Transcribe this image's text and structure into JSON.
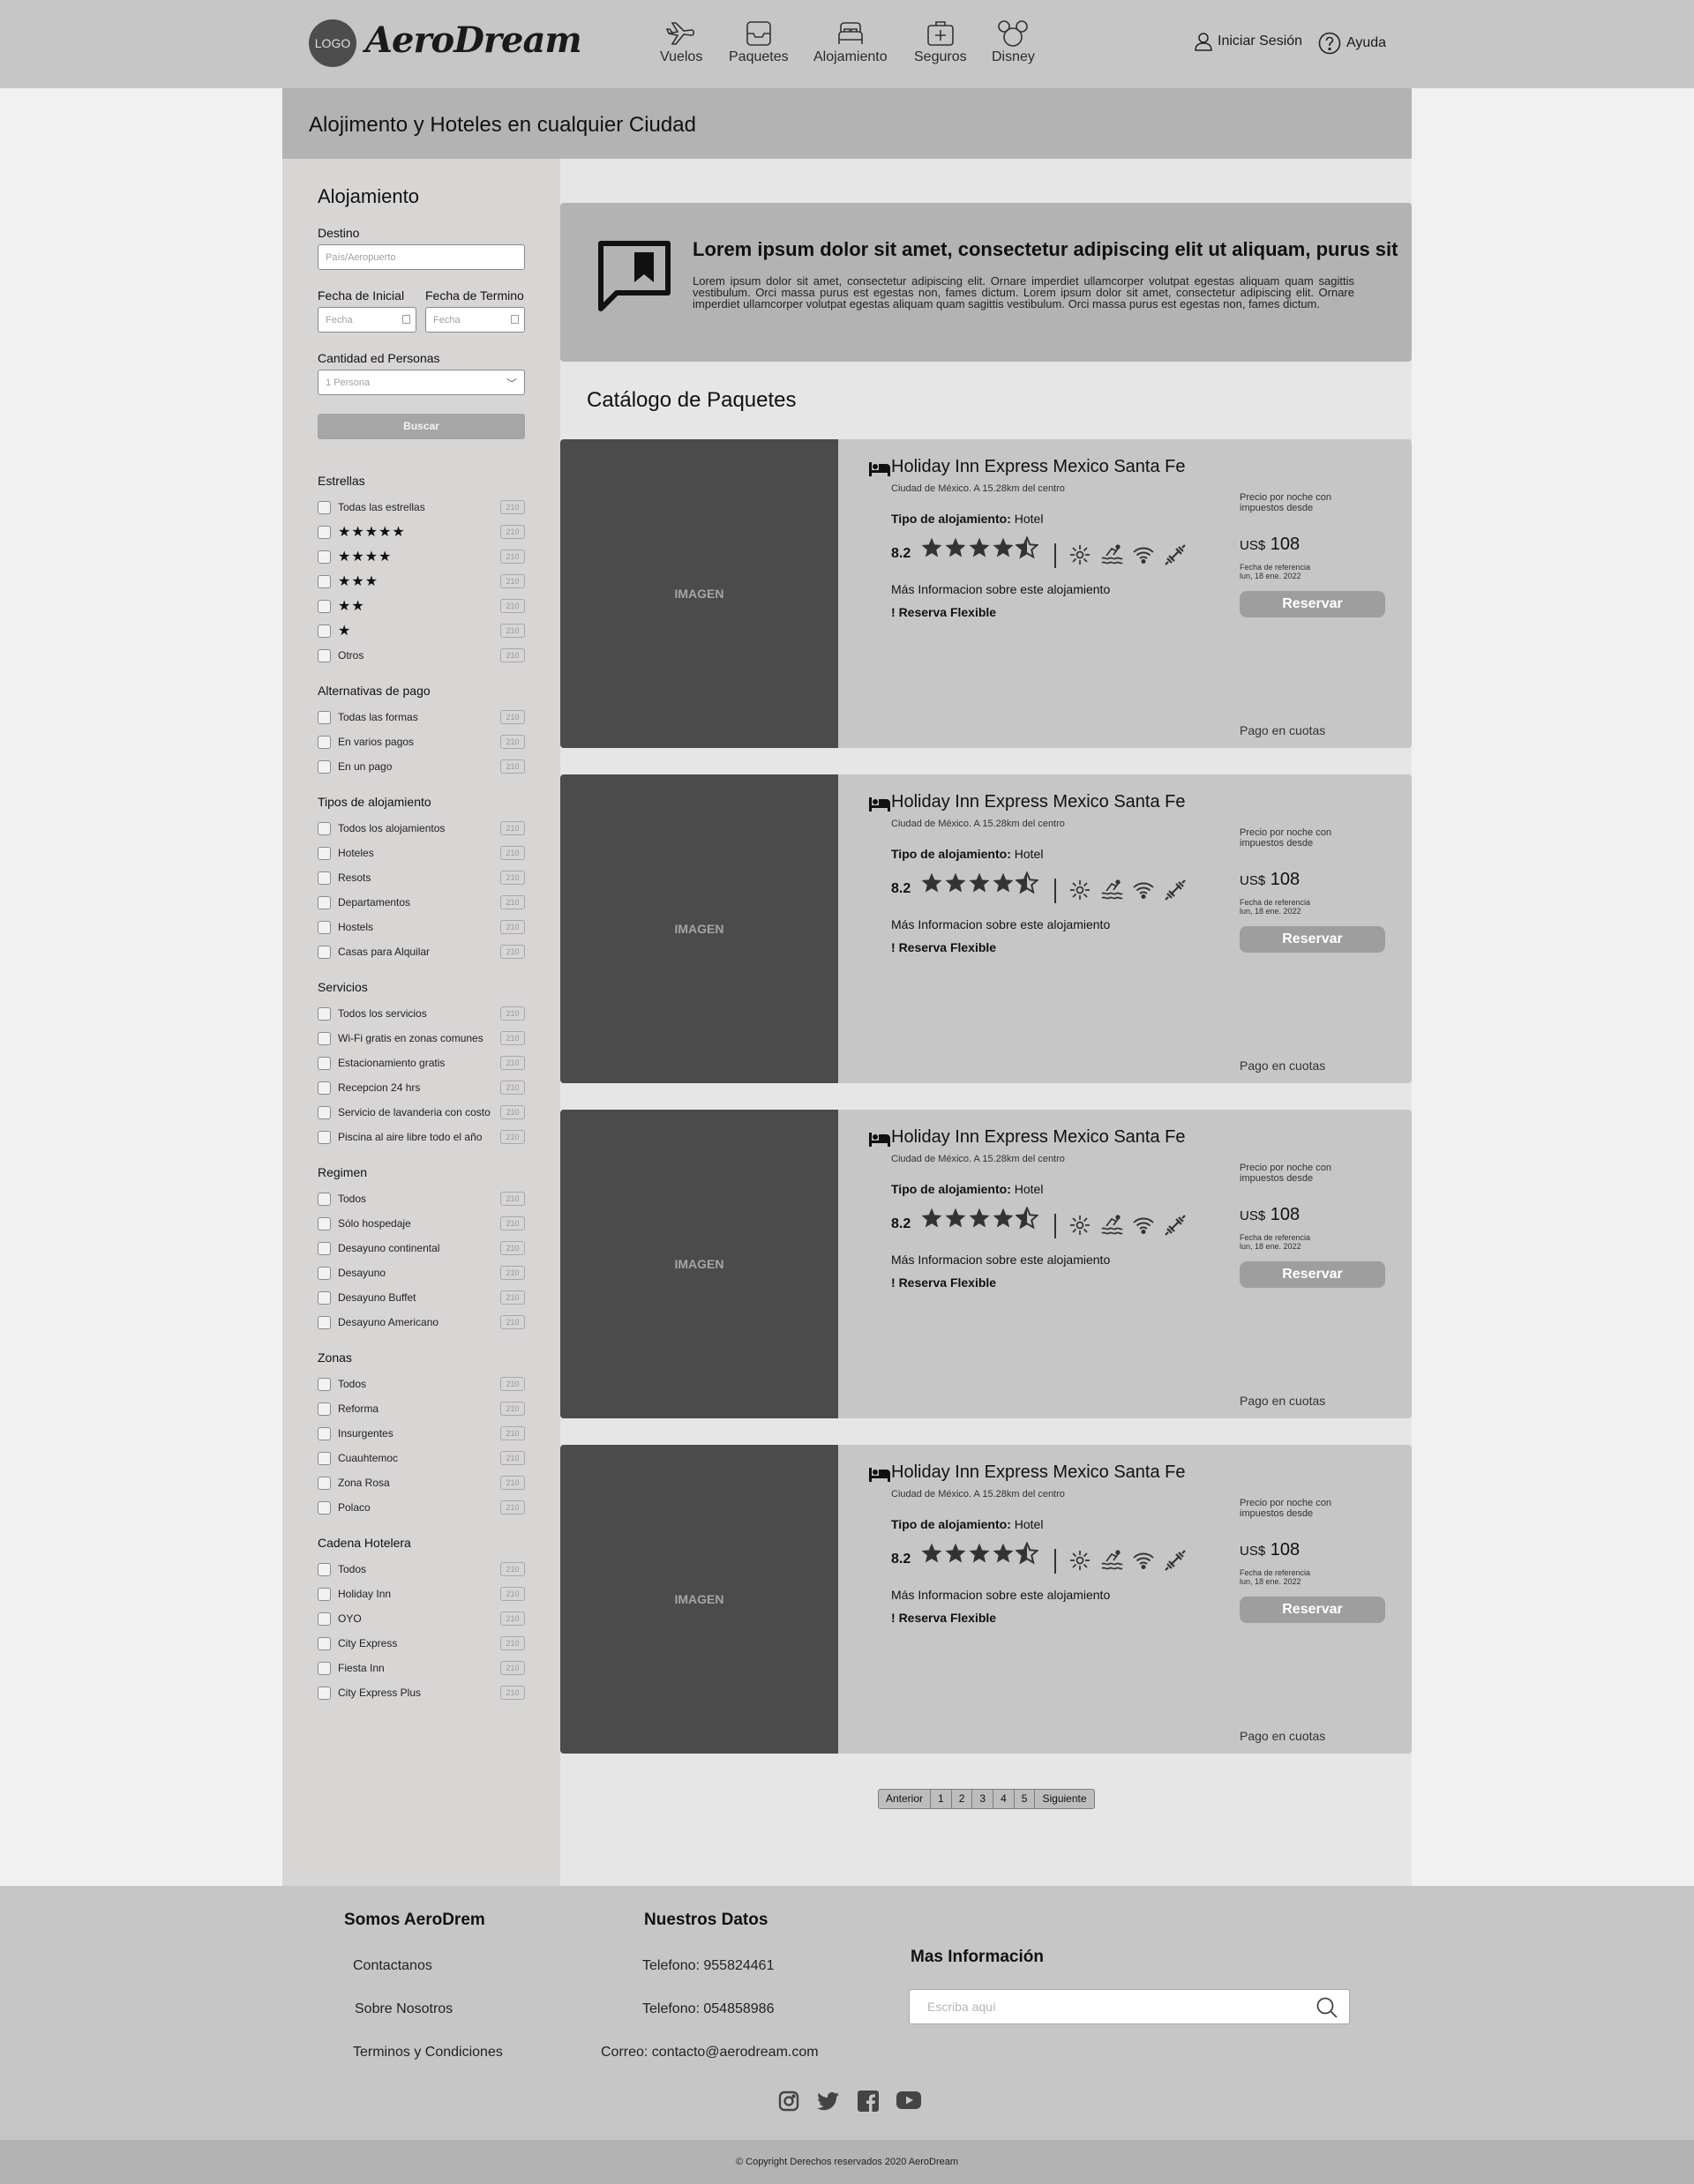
{
  "header": {
    "logo_text": "LOGO",
    "brand": "AeroDream",
    "nav": [
      {
        "label": "Vuelos",
        "icon": "airplane-icon"
      },
      {
        "label": "Paquetes",
        "icon": "package-icon"
      },
      {
        "label": "Alojamiento",
        "icon": "bed-icon"
      },
      {
        "label": "Seguros",
        "icon": "medical-kit-icon"
      },
      {
        "label": "Disney",
        "icon": "mickey-icon"
      }
    ],
    "login": "Iniciar Sesión",
    "help": "Ayuda"
  },
  "page_title": "Alojimento y Hoteles en cualquier Ciudad",
  "search": {
    "title": "Alojamiento",
    "destino_label": "Destino",
    "destino_placeholder": "País/Aeropuerto",
    "fecha_inicial_label": "Fecha de Inicial",
    "fecha_termino_label": "Fecha de Termino",
    "fecha_placeholder": "Fecha",
    "personas_label": "Cantidad ed Personas",
    "personas_value": "1 Persona",
    "button": "Buscar"
  },
  "filters": [
    {
      "title": "Estrellas",
      "items": [
        {
          "label": "Todas las estrellas",
          "count": "210"
        },
        {
          "label": "★★★★★",
          "count": "210",
          "stars": true
        },
        {
          "label": "★★★★",
          "count": "210",
          "stars": true
        },
        {
          "label": "★★★",
          "count": "210",
          "stars": true
        },
        {
          "label": "★★",
          "count": "210",
          "stars": true
        },
        {
          "label": "★",
          "count": "210",
          "stars": true
        },
        {
          "label": "Otros",
          "count": "210"
        }
      ]
    },
    {
      "title": "Alternativas de pago",
      "items": [
        {
          "label": "Todas las formas",
          "count": "210"
        },
        {
          "label": "En varios pagos",
          "count": "210"
        },
        {
          "label": "En un pago",
          "count": "210"
        }
      ]
    },
    {
      "title": "Tipos de alojamiento",
      "items": [
        {
          "label": "Todos los alojamientos",
          "count": "210"
        },
        {
          "label": "Hoteles",
          "count": "210"
        },
        {
          "label": "Resots",
          "count": "210"
        },
        {
          "label": "Departamentos",
          "count": "210"
        },
        {
          "label": "Hostels",
          "count": "210"
        },
        {
          "label": "Casas para Alquilar",
          "count": "210"
        }
      ]
    },
    {
      "title": "Servicios",
      "items": [
        {
          "label": "Todos los servicios",
          "count": "210"
        },
        {
          "label": "Wi-Fi gratis en zonas comunes",
          "count": "210"
        },
        {
          "label": "Estacionamiento gratis",
          "count": "210"
        },
        {
          "label": "Recepcion 24 hrs",
          "count": "210"
        },
        {
          "label": "Servicio de lavanderia con costo",
          "count": "210"
        },
        {
          "label": "Piscina al aire libre todo el año",
          "count": "210"
        }
      ]
    },
    {
      "title": "Regimen",
      "items": [
        {
          "label": "Todos",
          "count": "210"
        },
        {
          "label": "Sólo hospedaje",
          "count": "210"
        },
        {
          "label": "Desayuno continental",
          "count": "210"
        },
        {
          "label": "Desayuno",
          "count": "210"
        },
        {
          "label": "Desayuno Buffet",
          "count": "210"
        },
        {
          "label": "Desayuno Americano",
          "count": "210"
        }
      ]
    },
    {
      "title": "Zonas",
      "items": [
        {
          "label": "Todos",
          "count": "210"
        },
        {
          "label": "Reforma",
          "count": "210"
        },
        {
          "label": "Insurgentes",
          "count": "210"
        },
        {
          "label": "Cuauhtemoc",
          "count": "210"
        },
        {
          "label": "Zona Rosa",
          "count": "210"
        },
        {
          "label": "Polaco",
          "count": "210"
        }
      ]
    },
    {
      "title": "Cadena Hotelera",
      "items": [
        {
          "label": "Todos",
          "count": "210"
        },
        {
          "label": "Holiday Inn",
          "count": "210"
        },
        {
          "label": "OYO",
          "count": "210"
        },
        {
          "label": "City Express",
          "count": "210"
        },
        {
          "label": "Fiesta Inn",
          "count": "210"
        },
        {
          "label": "City Express Plus",
          "count": "210"
        }
      ]
    }
  ],
  "promo": {
    "icon": "bookmark-chat-icon",
    "title": "Lorem ipsum dolor sit amet, consectetur adipiscing elit ut aliquam, purus sit",
    "body": "Lorem ipsum dolor sit amet, consectetur adipiscing elit. Ornare imperdiet ullamcorper volutpat egestas aliquam quam sagittis vestibulum. Orci massa purus est egestas non, fames dictum. Lorem ipsum dolor sit amet, consectetur adipiscing elit. Ornare imperdiet ullamcorper volutpat egestas aliquam quam sagittis vestibulum. Orci massa purus est egestas non, fames dictum."
  },
  "catalog_title": "Catálogo de Paquetes",
  "cards": [
    {
      "image": "IMAGEN",
      "name": "Holiday Inn Express Mexico Santa Fe",
      "location": "Ciudad de México. A 15.28km del centro",
      "type_label": "Tipo de alojamiento:",
      "type": "Hotel",
      "score": "8.2",
      "rating": 4.5,
      "more": "Más Informacion sobre este alojamiento",
      "flex": "Reserva Flexible",
      "price_label": "Precio por noche con impuestos desde",
      "currency": "US$",
      "price": "108",
      "ref_label": "Fecha de referencia",
      "ref_date": "lun, 18 ene. 2022",
      "button": "Reservar",
      "cuotas": "Pago en cuotas"
    },
    {
      "image": "IMAGEN",
      "name": "Holiday Inn Express Mexico Santa Fe",
      "location": "Ciudad de México. A 15.28km del centro",
      "type_label": "Tipo de alojamiento:",
      "type": "Hotel",
      "score": "8.2",
      "rating": 4.5,
      "more": "Más Informacion sobre este alojamiento",
      "flex": "Reserva Flexible",
      "price_label": "Precio por noche con impuestos desde",
      "currency": "US$",
      "price": "108",
      "ref_label": "Fecha de referencia",
      "ref_date": "lun, 18 ene. 2022",
      "button": "Reservar",
      "cuotas": "Pago en cuotas"
    },
    {
      "image": "IMAGEN",
      "name": "Holiday Inn Express Mexico Santa Fe",
      "location": "Ciudad de México. A 15.28km del centro",
      "type_label": "Tipo de alojamiento:",
      "type": "Hotel",
      "score": "8.2",
      "rating": 4.5,
      "more": "Más Informacion sobre este alojamiento",
      "flex": "Reserva Flexible",
      "price_label": "Precio por noche con impuestos desde",
      "currency": "US$",
      "price": "108",
      "ref_label": "Fecha de referencia",
      "ref_date": "lun, 18 ene. 2022",
      "button": "Reservar",
      "cuotas": "Pago en cuotas"
    },
    {
      "image": "IMAGEN",
      "name": "Holiday Inn Express Mexico Santa Fe",
      "location": "Ciudad de México. A 15.28km del centro",
      "type_label": "Tipo de alojamiento:",
      "type": "Hotel",
      "score": "8.2",
      "rating": 4.5,
      "more": "Más Informacion sobre este alojamiento",
      "flex": "Reserva Flexible",
      "price_label": "Precio por noche con impuestos desde",
      "currency": "US$",
      "price": "108",
      "ref_label": "Fecha de referencia",
      "ref_date": "lun, 18 ene. 2022",
      "button": "Reservar",
      "cuotas": "Pago en cuotas"
    }
  ],
  "amenities": [
    "sun-icon",
    "pool-icon",
    "wifi-icon",
    "gym-icon"
  ],
  "pagination": {
    "prev": "Anterior",
    "pages": [
      "1",
      "2",
      "3",
      "4",
      "5"
    ],
    "next": "Siguiente"
  },
  "footer": {
    "col1_title": "Somos AeroDrem",
    "col1_links": [
      "Contactanos",
      "Sobre Nosotros",
      "Terminos y Condiciones"
    ],
    "col2_title": "Nuestros Datos",
    "col2_lines": [
      "Telefono: 955824461",
      "Telefono: 054858986",
      "Correo: contacto@aerodream.com"
    ],
    "col3_title": "Mas Información",
    "search_placeholder": "Escriba aquí",
    "social": [
      "instagram-icon",
      "twitter-icon",
      "facebook-icon",
      "youtube-icon"
    ],
    "copyright": "© Copyright Derechos reservados 2020 AeroDream"
  }
}
